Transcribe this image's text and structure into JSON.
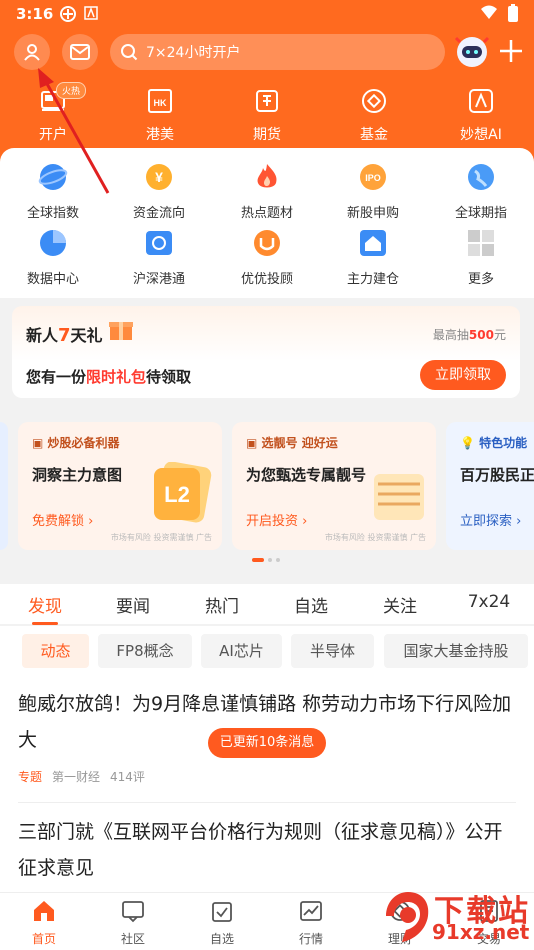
{
  "status_bar": {
    "time": "3:16"
  },
  "search": {
    "placeholder": "7×24小时开户"
  },
  "top_nav": [
    {
      "label": "开户",
      "icon": "account-open-icon",
      "badge": "火热"
    },
    {
      "label": "港美",
      "icon": "hk-us-icon"
    },
    {
      "label": "期货",
      "icon": "futures-icon"
    },
    {
      "label": "基金",
      "icon": "fund-icon"
    },
    {
      "label": "妙想AI",
      "icon": "ai-icon"
    }
  ],
  "quick": [
    {
      "label": "全球指数",
      "icon": "globe-icon"
    },
    {
      "label": "资金流向",
      "icon": "money-flow-icon"
    },
    {
      "label": "热点题材",
      "icon": "fire-icon"
    },
    {
      "label": "新股申购",
      "icon": "ipo-icon"
    },
    {
      "label": "全球期指",
      "icon": "globe-futures-icon"
    },
    {
      "label": "数据中心",
      "icon": "pie-chart-icon"
    },
    {
      "label": "沪深港通",
      "icon": "hk-connect-icon"
    },
    {
      "label": "优优投顾",
      "icon": "advisor-icon"
    },
    {
      "label": "主力建仓",
      "icon": "house-chart-icon"
    },
    {
      "label": "更多",
      "icon": "more-grid-icon"
    }
  ],
  "promo": {
    "title_pre": "新人",
    "title_hl": "7",
    "title_post": "天礼",
    "max_pre": "最高抽",
    "max_val": "500",
    "max_post": "元",
    "line_pre": "您有一份",
    "line_hl": "限时礼包",
    "line_post": "待领取",
    "button": "立即领取"
  },
  "banners": [
    {
      "tag": "炒股必备利器",
      "title": "洞察主力意图",
      "action": "免费解锁 ›",
      "disclaimer": "市场有风险 投资需谨慎 广告"
    },
    {
      "tag": "选靓号 迎好运",
      "title": "为您甄选专属靓号",
      "action": "开启投资 ›",
      "disclaimer": "市场有风险 投资需谨慎 广告"
    },
    {
      "tag": "特色功能",
      "title": "百万股民正",
      "action": "立即探索 ›"
    }
  ],
  "tabs": [
    "发现",
    "要闻",
    "热门",
    "自选",
    "关注",
    "7x24"
  ],
  "chips": [
    "动态",
    "FP8概念",
    "AI芯片",
    "半导体",
    "国家大基金持股"
  ],
  "feed": {
    "news1": "鲍威尔放鸽！为9月降息谨慎铺路 称劳动力市场下行风险加大",
    "updated": "已更新10条消息",
    "meta_tag": "专题",
    "meta_source": "第一财经",
    "meta_comments": "414评",
    "news2": "三部门就《互联网平台价格行为规则（征求意见稿）》公开征求意见"
  },
  "bottom_nav": [
    {
      "label": "首页",
      "icon": "home-icon"
    },
    {
      "label": "社区",
      "icon": "community-icon"
    },
    {
      "label": "自选",
      "icon": "watchlist-icon"
    },
    {
      "label": "行情",
      "icon": "market-icon"
    },
    {
      "label": "理财",
      "icon": "wealth-icon"
    },
    {
      "label": "交易",
      "icon": "trade-icon"
    }
  ],
  "watermark": {
    "line1": "下载站",
    "line2": "91xz.net"
  },
  "colors": {
    "brand": "#ff6a1f",
    "accent": "#ff5a1f",
    "annotation_arrow": "#e02020"
  }
}
